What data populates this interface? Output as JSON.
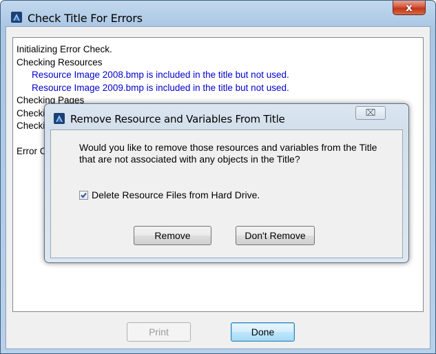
{
  "window": {
    "title": "Check Title For Errors",
    "close_glyph": "x"
  },
  "log": {
    "lines": [
      {
        "text": "Initializing Error Check.",
        "indent": 0
      },
      {
        "text": "Checking Resources",
        "indent": 0
      },
      {
        "text": "Resource Image 2008.bmp is included in the title but not used.",
        "indent": 1
      },
      {
        "text": "Resource Image 2009.bmp is included in the title but not used.",
        "indent": 1
      },
      {
        "text": "Checking Pages",
        "indent": 0
      },
      {
        "text": "Checking Objects",
        "indent": 0
      },
      {
        "text": "Checking Variables",
        "indent": 0
      },
      {
        "text": "",
        "indent": 0
      },
      {
        "text": "Error Check Complete.",
        "indent": 0
      }
    ]
  },
  "buttons": {
    "print_label": "Print",
    "done_label": "Done"
  },
  "dialog": {
    "title": "Remove Resource and Variables From Title",
    "close_glyph": "⌧",
    "message": "Would you like to remove those resources and variables from the Title that are not associated with any objects in the Title?",
    "checkbox_label": "Delete Resource Files from Hard Drive.",
    "checkbox_checked": true,
    "remove_label": "Remove",
    "dont_remove_label": "Don't Remove"
  },
  "colors": {
    "log_highlight": "#0000cc",
    "titlebar": "#b8d1ea",
    "close_button": "#c43516"
  },
  "icons": {
    "app": "app-logo-icon",
    "close": "close-icon",
    "check": "checkmark-icon"
  }
}
